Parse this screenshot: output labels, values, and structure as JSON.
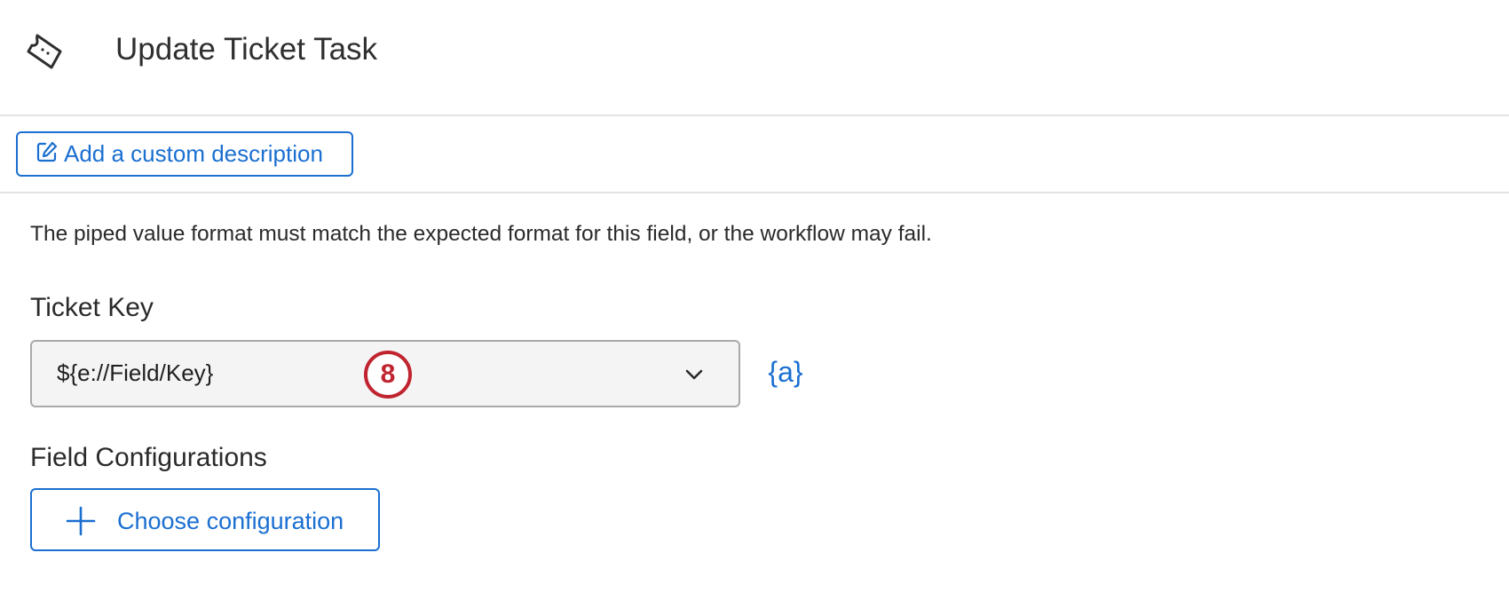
{
  "header": {
    "icon": "ticket-icon",
    "title": "Update Ticket Task"
  },
  "description": {
    "icon": "edit-icon",
    "button_label": "Add a custom description"
  },
  "help_text": "The piped value format must match the expected format for this field, or the workflow may fail.",
  "ticket_key": {
    "label": "Ticket Key",
    "value": "${e://Field/Key}",
    "dropdown_icon": "chevron-down-icon",
    "piped_text_icon": "piped-text-icon",
    "piped_text_label": "{a}"
  },
  "step_badge": "8",
  "field_configurations": {
    "label": "Field Configurations",
    "icon": "plus-icon",
    "button_label": "Choose configuration"
  },
  "colors": {
    "accent": "#1a6fd1",
    "badge": "#c0242f",
    "divider": "#e3e3e3",
    "input_bg": "#f4f4f5"
  }
}
